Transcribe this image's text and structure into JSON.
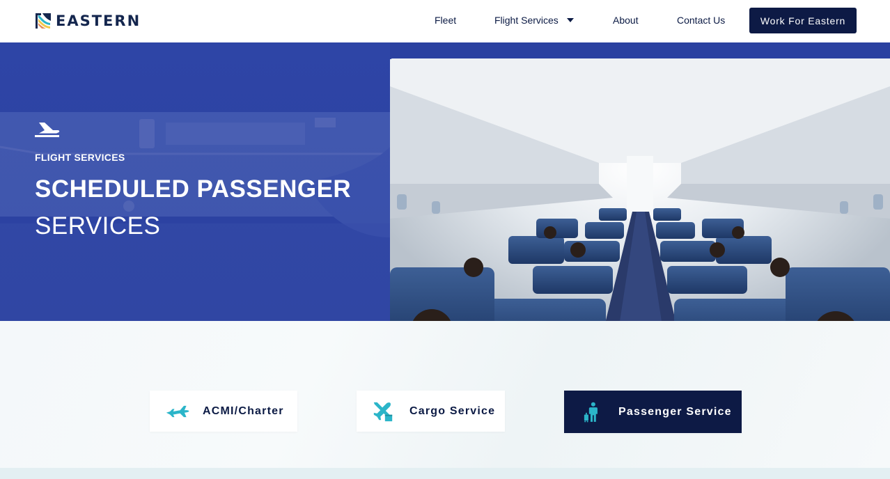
{
  "brand": {
    "name": "EASTERN",
    "colors": {
      "navy": "#0d1a45",
      "hero_blue": "#2e45a6",
      "accent_teal": "#2bb5c9"
    }
  },
  "nav": {
    "fleet": "Fleet",
    "flight_services": "Flight Services",
    "about": "About",
    "contact": "Contact Us",
    "cta": "Work For Eastern"
  },
  "hero": {
    "icon": "departing-plane-icon",
    "eyebrow": "FLIGHT SERVICES",
    "title_line1": "SCHEDULED PASSENGER",
    "title_line2": "SERVICES",
    "image": "aircraft-cabin-photo"
  },
  "services": [
    {
      "label": "ACMI/Charter",
      "icon": "airplane-icon",
      "active": false
    },
    {
      "label": "Cargo Service",
      "icon": "cargo-plane-icon",
      "active": false
    },
    {
      "label": "Passenger Service",
      "icon": "passenger-luggage-icon",
      "active": true
    }
  ]
}
